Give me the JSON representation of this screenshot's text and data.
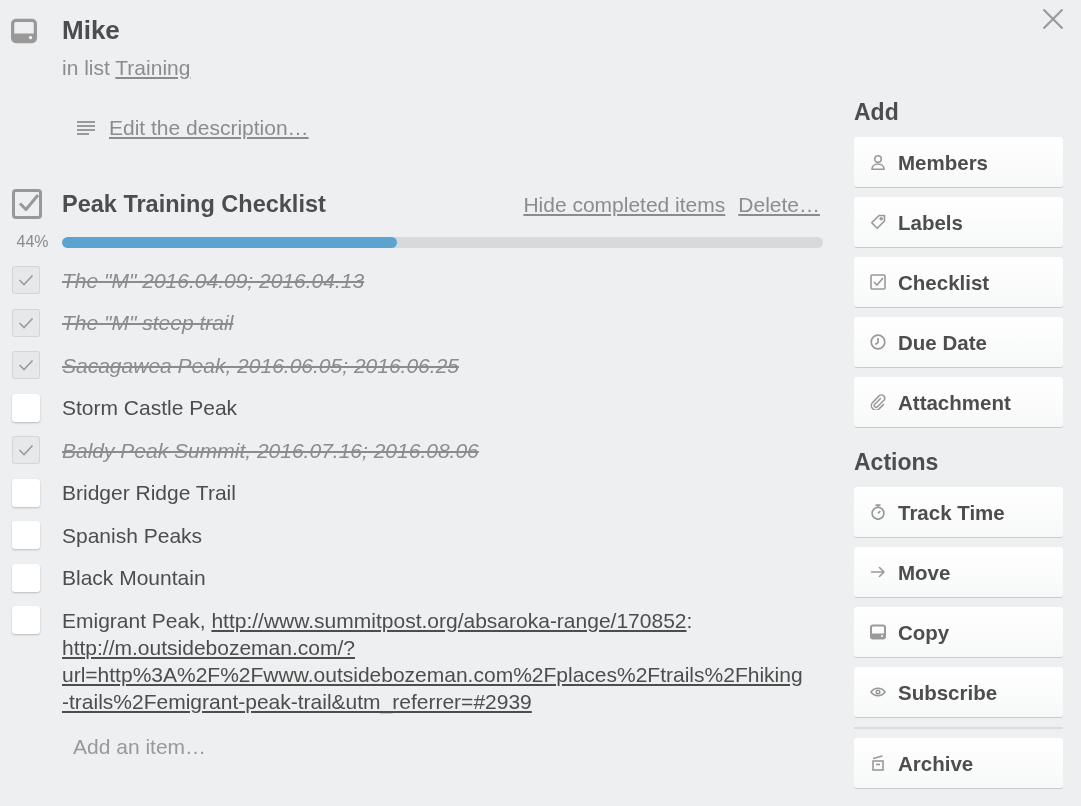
{
  "card": {
    "title": "Mike",
    "list_label": "in list",
    "list_name": "Training"
  },
  "description": {
    "link": "Edit the description…"
  },
  "checklist": {
    "title": "Peak Training Checklist",
    "actions": [
      "Hide completed items",
      "Delete…"
    ],
    "percent": "44%",
    "level": 0.44,
    "items": [
      {
        "checked": true,
        "text": "The \"M\" 2016.04.09; 2016.04.13"
      },
      {
        "checked": true,
        "text": "The \"M\" steep trail"
      },
      {
        "checked": true,
        "text": "Sacagawea Peak, 2016.06.05; 2016.06.25"
      },
      {
        "checked": false,
        "text": "Storm Castle Peak"
      },
      {
        "checked": true,
        "text": "Baldy Peak Summit, 2016.07.16; 2016.08.06"
      },
      {
        "checked": false,
        "text": "Bridger Ridge Trail"
      },
      {
        "checked": false,
        "text": "Spanish Peaks"
      },
      {
        "checked": false,
        "text": "Black Mountain"
      },
      {
        "checked": false,
        "parts": [
          {
            "kind": "text",
            "text": "Emigrant Peak, "
          },
          {
            "kind": "link",
            "text": "http://www.summitpost.org/absaroka-range/170852"
          },
          {
            "kind": "text",
            "text": ": "
          },
          {
            "kind": "link",
            "text": "http://m.outsidebozeman.com/?url=http%3A%2F%2Fwww.outsidebozeman.com%2Fplaces%2Ftrails%2Fhiking-trails%2Femigrant-peak-trail&utm_referrer=#2939"
          }
        ]
      }
    ],
    "add_item": {
      "placeholder": "Add an item…"
    }
  },
  "sidebar": {
    "sections": [
      {
        "title": "Add",
        "buttons": [
          "Members",
          "Labels",
          "Checklist",
          "Due Date",
          "Attachment"
        ]
      },
      {
        "title": "Actions",
        "buttons": [
          "Track Time",
          "Move",
          "Copy",
          "Subscribe"
        ]
      },
      {
        "buttons": [
          "Archive"
        ]
      }
    ]
  }
}
